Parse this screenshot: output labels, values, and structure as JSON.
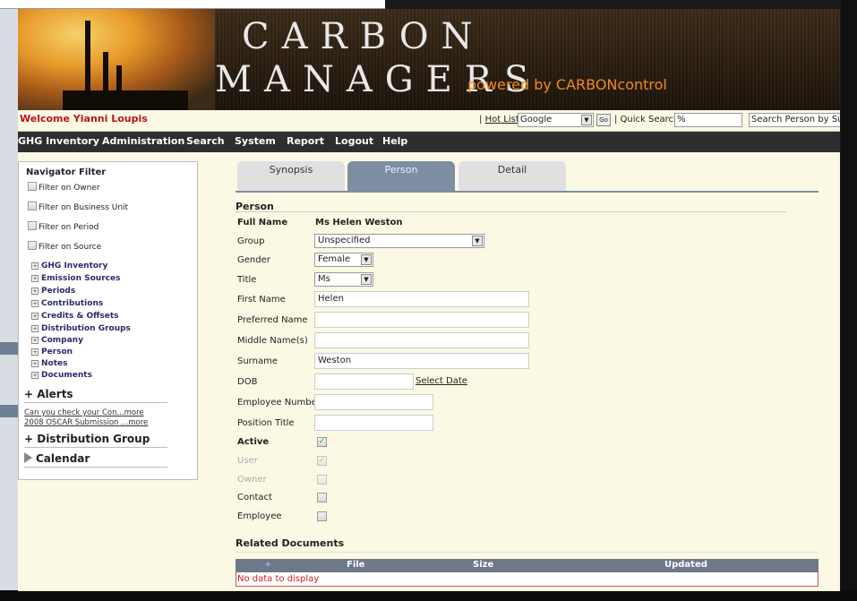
{
  "header": {
    "logo_line1": "CARBON",
    "logo_line2": "MANAGERS",
    "powered_by": "powered by CARBONcontrol",
    "welcome": "Welcome Yianni Loupis",
    "hotlist_label": "Hot List",
    "hotlist_selected": "Google",
    "go_label": "Go",
    "quick_search_label": "| Quick Search",
    "quick_search_value": "%",
    "person_search_value": "Search Person by Surname"
  },
  "menu": [
    "GHG Inventory",
    "Administration",
    "Search",
    "System",
    "Report",
    "Logout",
    "Help"
  ],
  "nav": {
    "title": "Navigator Filter",
    "filters": [
      "Filter on Owner",
      "Filter on Business Unit",
      "Filter on Period",
      "Filter on Source"
    ],
    "tree": [
      "GHG Inventory",
      "Emission Sources",
      "Periods",
      "Contributions",
      "Credits & Offsets",
      "Distribution Groups",
      "Company",
      "Person",
      "Notes",
      "Documents"
    ],
    "alerts_title": "+ Alerts",
    "alerts": [
      "Can you check your Con...more",
      "2008 OSCAR Submission ...more"
    ],
    "distribution_title": "+ Distribution Group",
    "calendar_title": "Calendar"
  },
  "tabs": [
    "Synopsis",
    "Person",
    "Detail"
  ],
  "person": {
    "section_title": "Person",
    "full_name_label": "Full Name",
    "full_name": "Ms Helen Weston",
    "group_label": "Group",
    "group": "Unspecified",
    "gender_label": "Gender",
    "gender": "Female",
    "title_label": "Title",
    "title": "Ms",
    "first_name_label": "First Name",
    "first_name": "Helen",
    "preferred_name_label": "Preferred Name",
    "preferred_name": "",
    "middle_name_label": "Middle Name(s)",
    "middle_name": "",
    "surname_label": "Surname",
    "surname": "Weston",
    "dob_label": "DOB",
    "dob": "",
    "select_date": "Select Date",
    "employee_number_label": "Employee Number",
    "employee_number": "",
    "position_title_label": "Position Title",
    "position_title": "",
    "active_label": "Active",
    "user_label": "User",
    "owner_label": "Owner",
    "contact_label": "Contact",
    "employee_label": "Employee"
  },
  "related": {
    "title": "Related Documents",
    "add": "+",
    "columns": [
      "File",
      "Size",
      "Updated"
    ],
    "empty": "No data to display"
  }
}
